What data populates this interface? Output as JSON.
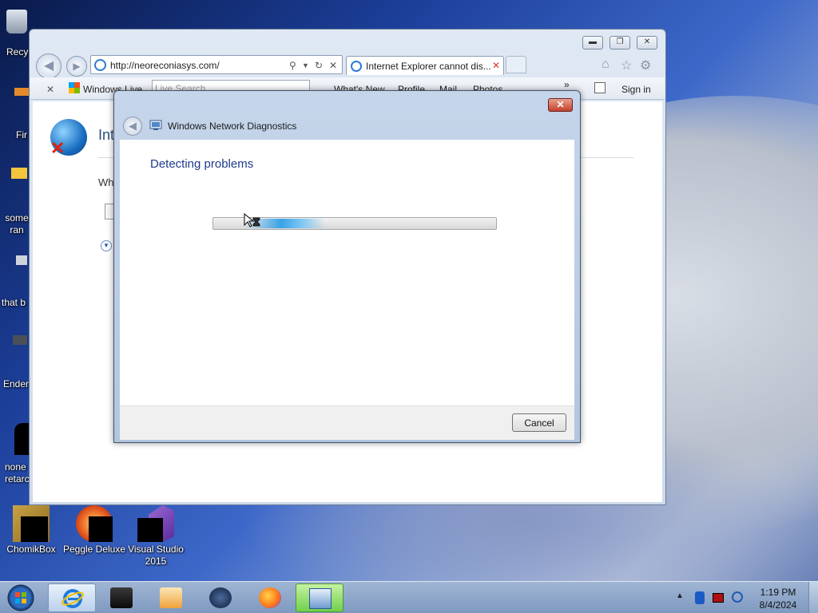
{
  "desktop": {
    "icons_left": [
      {
        "label": "Recy"
      },
      {
        "label": "Fir"
      },
      {
        "label": "some\nran"
      },
      {
        "label": "that b"
      },
      {
        "label": "Ender"
      },
      {
        "label": "none\nretarc"
      }
    ],
    "icons_bottom": [
      {
        "label": "ChomikBox"
      },
      {
        "label": "Peggle Deluxe"
      },
      {
        "label": "Visual Studio\n2015"
      }
    ]
  },
  "ie": {
    "address": "http://neoreconiasys.com/",
    "tab_title": "Internet Explorer cannot dis...",
    "toolbar": {
      "windows_live": "Windows Live",
      "search_placeholder": "Live Search",
      "whats_new": "What's New",
      "profile": "Profile",
      "mail": "Mail",
      "photos": "Photos",
      "sign_in": "Sign in"
    },
    "content": {
      "title_peek": "Int",
      "text_peek": "Wh"
    }
  },
  "dialog": {
    "title": "Windows Network Diagnostics",
    "heading": "Detecting problems",
    "cancel_label": "Cancel",
    "progress": "indeterminate"
  },
  "taskbar": {
    "clock_time": "1:19 PM",
    "clock_date": "8/4/2024"
  },
  "colors": {
    "dialog_heading": "#1e3b8a",
    "progress_fill": "#38a3e6",
    "close_button": "#c3402b"
  }
}
